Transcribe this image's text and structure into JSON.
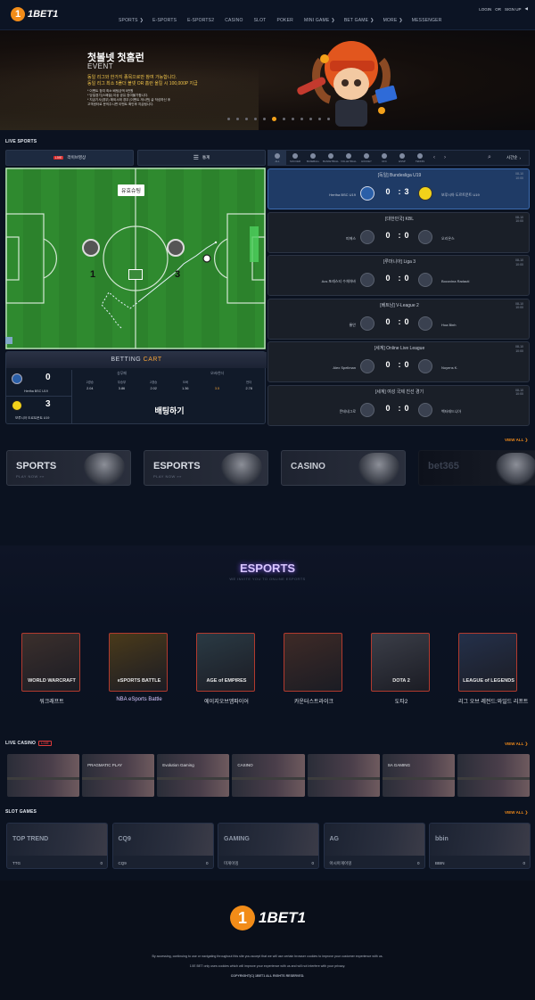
{
  "header": {
    "logo_text": "1BET1",
    "nav": [
      "SPORTS",
      "E-SPORTS",
      "E-SPORTS2",
      "CASINO",
      "SLOT",
      "POKER",
      "MINI GAME",
      "BET GAME",
      "MORE",
      "MESSENGER"
    ],
    "nav_arrows": [
      "❯",
      "",
      "",
      "",
      "",
      "",
      "❯",
      "❯",
      "❯",
      ""
    ],
    "login": "LOGIN",
    "or": "OR",
    "signup": "SIGN UP"
  },
  "banner": {
    "title": "첫볼넷 첫홈런",
    "subtitle": "EVENT",
    "line1": "동일 리그와 한가지 종목으로만 참여 가능합니다.",
    "line2": "동일 리그 최소 5폴더 볼넷 OR 홈런 올킬 시 100,000P 지급",
    "note1": "* 이벤트 참여 최소 배팅금액 5만원",
    "note2": "* 당일경기(스폐셜) 이상 공유 참여불가합니다.",
    "note3": "* 지급기사(경우) 해외시에 경우 [이벤트 게시판] 글 작성하신 후",
    "note4": "고객센터로 문의주시면 이벤트 확인후 지급됩니다.",
    "slides": 12,
    "active_slide": 5,
    "dot_colors": [
      "#6a6a72",
      "#f4a11a"
    ]
  },
  "live_sports": {
    "section_title": "LIVE SPORTS",
    "tab_live_badge": "LIVE",
    "tab_live": "라이브영상",
    "tab_stats": "통계",
    "pitch_label": "유효슈팅",
    "pitch_home_score": "1",
    "pitch_away_score": "3",
    "sports": [
      "ALL",
      "SOCCER",
      "BASEBALL",
      "BASKETBALL",
      "VOLLEYBALL",
      "HOCKEY",
      "UFC",
      "ESSP",
      "TENNIS"
    ],
    "sports_time_label": "시간순",
    "betting_cart": {
      "title_1": "BETTING",
      "title_2": "CART",
      "home": {
        "name": "Hertha BSC U19",
        "score": "0"
      },
      "away": {
        "name": "보루시아 도르트문트 U19",
        "score": "3"
      },
      "cols": [
        "승무패",
        "",
        "",
        "오버/언더",
        ""
      ],
      "sub": [
        "2경승",
        "무승부",
        "2경승",
        "오버",
        "",
        "언더"
      ],
      "odds": [
        "2.04",
        "3.86",
        "2.02",
        "1.36",
        "3.5",
        "2.78"
      ],
      "bet_button": "배팅하기"
    },
    "matches": [
      {
        "league": "[독일] Bundesliga U19",
        "date": "08-10",
        "time": "10:00",
        "home": "Hertha BSC U19",
        "away": "보루시아 도르트문트 U19",
        "home_score": "0",
        "away_score": "3",
        "selected": true
      },
      {
        "league": "[대한민국] KBL",
        "date": "08-10",
        "time": "10:00",
        "home": "피에스",
        "away": "오리온스",
        "home_score": "0",
        "away_score": "0",
        "selected": false
      },
      {
        "league": "[루마니아] Liga 3",
        "date": "08-10",
        "time": "10:00",
        "home": "Acs 포레스티 수체아바",
        "away": "Bocovina Radauti",
        "home_score": "0",
        "away_score": "0",
        "selected": false
      },
      {
        "league": "[베트남] V-League 2",
        "date": "08-10",
        "time": "10:00",
        "home": "롱안",
        "away": "Hoa Binh",
        "home_score": "0",
        "away_score": "0",
        "selected": false
      },
      {
        "league": "[세계] Online Live League",
        "date": "08-10",
        "time": "10:00",
        "home": "Alex Spellman",
        "away": "Noyens K.",
        "home_score": "0",
        "away_score": "0",
        "selected": false
      },
      {
        "league": "[세계] 여성 국제 친선 경기",
        "date": "08-10",
        "time": "10:00",
        "home": "몬테네그로",
        "away": "벡터레드니아",
        "home_score": "0",
        "away_score": "0",
        "selected": false
      }
    ]
  },
  "view_all": "VIEW ALL ❯",
  "promos": [
    {
      "title": "SPORTS",
      "sub": "PLAY NOW »»"
    },
    {
      "title": "ESPORTS",
      "sub": "PLAY NOW »»"
    },
    {
      "title": "CASINO",
      "sub": ""
    },
    {
      "title": "bet365",
      "sub": ""
    }
  ],
  "esports": {
    "title": "ESPORTS",
    "subtitle": "WE INVITE YOU TO ONLINE ESPORTS",
    "games": [
      {
        "art": "WORLD WARCRAFT",
        "label": "워크래프트"
      },
      {
        "art": "eSPORTS BATTLE",
        "label": "NBA eSports Battle"
      },
      {
        "art": "AGE of EMPIRES",
        "label": "에이지오브엠파이어"
      },
      {
        "art": "",
        "label": "카운터스트라이크"
      },
      {
        "art": "DOTA 2",
        "label": "도타2"
      },
      {
        "art": "LEAGUE of LEGENDS",
        "label": "리그 오브 레전드:와일드 리프트"
      }
    ]
  },
  "live_casino": {
    "title": "LIVE CASINO",
    "badge": "LIVE",
    "providers": [
      "",
      "PRAGMATIC PLAY",
      "Evolution Gaming",
      "CASINO",
      "",
      "SA GAMING",
      ""
    ]
  },
  "slot_games": {
    "title": "SLOT GAMES",
    "items": [
      {
        "logo": "TOP TREND",
        "name": "TTG",
        "count": "0"
      },
      {
        "logo": "CQ9",
        "name": "CQ9",
        "count": "0"
      },
      {
        "logo": "GAMING",
        "name": "미게이밍",
        "count": "0"
      },
      {
        "logo": "AG",
        "name": "아시아게이밍",
        "count": "0"
      },
      {
        "logo": "bbin",
        "name": "BBIN",
        "count": "0"
      }
    ]
  },
  "footer": {
    "logo_text": "1BET1",
    "line1": "By accessing, continuing to use or navigating throughout this site you accept that we will use certain browser cookies to improve your customer experience with us.",
    "line2": "1XE BET only uses cookies which will improve your experience with us and will not interfere with your privacy.",
    "copyright": "COPYRIGHT(C) 1BET1 ALL RIGHTS RESERVED."
  }
}
